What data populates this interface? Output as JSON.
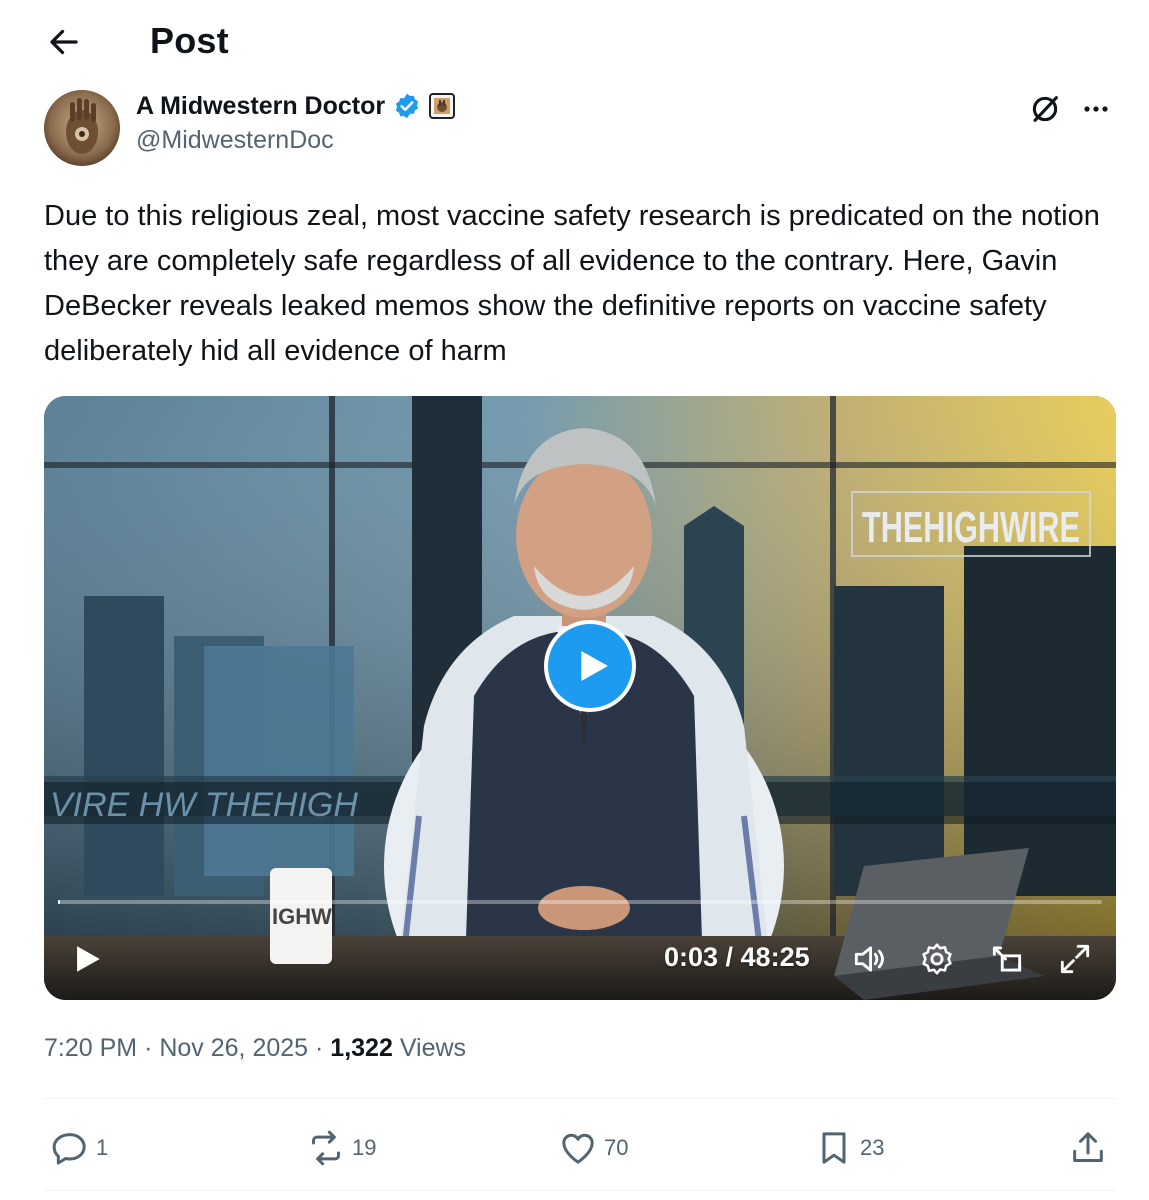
{
  "header": {
    "title": "Post",
    "back_icon": "arrow-left-icon"
  },
  "author": {
    "display_name": "A Midwestern Doctor",
    "handle": "@MidwesternDoc",
    "verified_color": "#1d9bf0",
    "icons": [
      "verified-badge-icon",
      "affiliation-badge-icon",
      "grok-icon",
      "more-icon"
    ]
  },
  "post": {
    "text": "Due to this religious zeal, most vaccine safety research is predicated on the notion they are completely safe regardless of all evidence to the contrary. Here, Gavin DeBecker reveals leaked memos show the definitive reports on vaccine safety deliberately hid all evidence of harm"
  },
  "video": {
    "current_time": "0:03",
    "duration": "48:25",
    "time_display": "0:03 / 48:25",
    "progress_fraction": 0.001,
    "overlay_brand": "THEHIGHWIRE",
    "mug_text": "IGHW",
    "banner_text": "VIRE   HW   THEHIGH",
    "play_color": "#1d9bf0",
    "controls": [
      "play-icon",
      "volume-icon",
      "settings-icon",
      "pip-icon",
      "fullscreen-icon"
    ]
  },
  "meta": {
    "time": "7:20 PM",
    "date": "Nov 26, 2025",
    "views_count": "1,322",
    "views_label": "Views",
    "separator": "·"
  },
  "actions": {
    "replies": "1",
    "reposts": "19",
    "likes": "70",
    "bookmarks": "23"
  },
  "colors": {
    "text": "#0f1419",
    "secondary": "#536471",
    "accent": "#1d9bf0"
  }
}
